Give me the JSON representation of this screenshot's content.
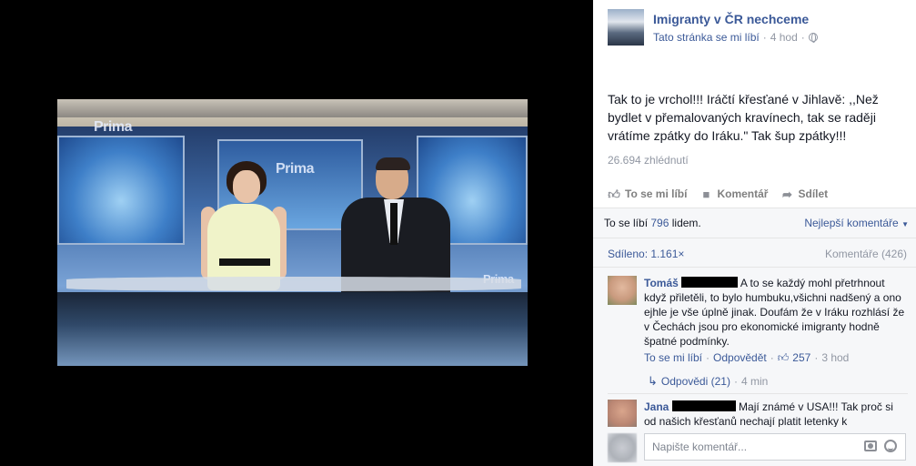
{
  "video": {
    "logo_text": "Prima"
  },
  "post": {
    "page_name": "Imigranty v ČR nechceme",
    "like_page": "Tato stránka se mi líbí",
    "separator": "·",
    "time": "4 hod",
    "text": "Tak to je vrchol!!! Iráčtí křesťané v Jihlavě: ,,Než bydlet v přemalovaných kravínech, tak se raději vrátíme zpátky do Iráku.\" Tak šup zpátky!!!",
    "views": "26.694 zhlédnutí"
  },
  "actions": {
    "like": "To se mi líbí",
    "comment": "Komentář",
    "share": "Sdílet"
  },
  "stats": {
    "likes_prefix": "To se líbí",
    "likes_count": "796",
    "likes_suffix": "lidem.",
    "best_comments": "Nejlepší komentáře",
    "shares": "Sdíleno: 1.161×",
    "comments": "Komentáře (426)"
  },
  "comments": [
    {
      "name": "Tomáš",
      "text": "A to se každý mohl přetrhnout když přiletěli, to bylo humbuku,všichni nadšený a ono ejhle je vše úplně jinak. Doufám že v Iráku rozhlásí že v Čechách jsou pro ekonomické imigranty hodně špatné podmínky.",
      "like": "To se mi líbí",
      "reply": "Odpovědět",
      "likes": "257",
      "time": "3 hod",
      "replies_label": "Odpovědi (21)",
      "replies_time": "4 min"
    },
    {
      "name": "Jana",
      "text": "Mají známé v USA!!! Tak proč si od našich křesťanů nechají platit letenky k"
    }
  ],
  "composer": {
    "placeholder": "Napište komentář..."
  },
  "icons": {
    "globe": "globe-icon",
    "like": "thumb-up-icon",
    "comment": "comment-bubble-icon",
    "share": "share-arrow-icon",
    "camera": "camera-icon",
    "emoji": "smiley-icon",
    "reply_arrow": "reply-arrow-icon",
    "dropdown": "caret-down-icon"
  },
  "colors": {
    "link": "#3b5998",
    "muted": "#9197a3",
    "text": "#141823"
  }
}
